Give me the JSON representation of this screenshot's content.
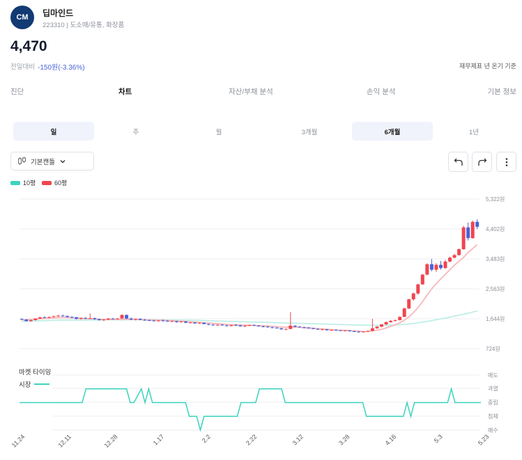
{
  "company": {
    "logo_text": "CM",
    "name": "딥마인드",
    "subtitle": "223310 | 도소매/유통, 화장품"
  },
  "quote": {
    "price": "4,470",
    "change_label": "전일대비",
    "change_value": "-150원(-3.36%)",
    "basis_note": "재무제표 년 온기 기준"
  },
  "tabs": [
    {
      "label": "진단",
      "active": false
    },
    {
      "label": "차트",
      "active": true
    },
    {
      "label": "자산/부채 분석",
      "active": false
    },
    {
      "label": "손익 분석",
      "active": false
    },
    {
      "label": "기본 정보",
      "active": false
    }
  ],
  "periods": [
    {
      "label": "일",
      "active": true
    },
    {
      "label": "주",
      "active": false
    },
    {
      "label": "월",
      "active": false
    },
    {
      "label": "3개월",
      "active": false
    },
    {
      "label": "6개월",
      "active": true
    },
    {
      "label": "1년",
      "active": false
    }
  ],
  "toolbar": {
    "chart_type_label": "기본캔들"
  },
  "icons": [
    "candle-icon",
    "chevron-down-icon",
    "undo-icon",
    "redo-icon",
    "more-vertical-icon"
  ],
  "colors": {
    "up": "#f0454f",
    "down": "#4a62d6",
    "ma10": "#3cd3bd",
    "ma60": "#f0454f"
  },
  "chart_data": [
    {
      "type": "candlestick",
      "legend": [
        {
          "name": "10평",
          "color": "#3cd3bd"
        },
        {
          "name": "60평",
          "color": "#f0454f"
        }
      ],
      "y_ticks": [
        "5,322원",
        "4,402원",
        "3,483원",
        "2,563원",
        "1,644원",
        "724원"
      ],
      "y_tick_values": [
        5322,
        4402,
        3483,
        2563,
        1644,
        724
      ],
      "ylim": [
        724,
        5322
      ],
      "x_ticks": [
        "11.24",
        "12.11",
        "12.28",
        "1.17",
        "2.2",
        "2.22",
        "3.12",
        "3.28",
        "4.16",
        "5.3",
        "5.23"
      ],
      "grid": true,
      "ohlc": [
        [
          1640,
          1650,
          1600,
          1620
        ],
        [
          1620,
          1630,
          1560,
          1570
        ],
        [
          1570,
          1620,
          1550,
          1600
        ],
        [
          1600,
          1660,
          1590,
          1650
        ],
        [
          1650,
          1700,
          1640,
          1690
        ],
        [
          1690,
          1720,
          1660,
          1680
        ],
        [
          1680,
          1710,
          1650,
          1700
        ],
        [
          1700,
          1740,
          1680,
          1720
        ],
        [
          1720,
          1760,
          1700,
          1740
        ],
        [
          1740,
          1770,
          1710,
          1730
        ],
        [
          1730,
          1740,
          1680,
          1700
        ],
        [
          1700,
          1720,
          1660,
          1690
        ],
        [
          1690,
          1700,
          1620,
          1640
        ],
        [
          1640,
          1680,
          1620,
          1670
        ],
        [
          1670,
          1690,
          1630,
          1650
        ],
        [
          1650,
          1800,
          1640,
          1660
        ],
        [
          1660,
          1680,
          1610,
          1630
        ],
        [
          1630,
          1650,
          1590,
          1600
        ],
        [
          1600,
          1630,
          1570,
          1620
        ],
        [
          1620,
          1660,
          1600,
          1650
        ],
        [
          1650,
          1670,
          1620,
          1640
        ],
        [
          1640,
          1660,
          1620,
          1650
        ],
        [
          1650,
          1780,
          1640,
          1760
        ],
        [
          1760,
          1770,
          1630,
          1650
        ],
        [
          1650,
          1680,
          1600,
          1620
        ],
        [
          1620,
          1650,
          1590,
          1640
        ],
        [
          1640,
          1660,
          1600,
          1610
        ],
        [
          1610,
          1640,
          1580,
          1600
        ],
        [
          1600,
          1620,
          1570,
          1590
        ],
        [
          1590,
          1610,
          1560,
          1570
        ],
        [
          1570,
          1600,
          1550,
          1590
        ],
        [
          1590,
          1620,
          1560,
          1580
        ],
        [
          1580,
          1600,
          1550,
          1560
        ],
        [
          1560,
          1590,
          1540,
          1570
        ],
        [
          1570,
          1580,
          1520,
          1540
        ],
        [
          1540,
          1570,
          1520,
          1560
        ],
        [
          1560,
          1570,
          1510,
          1520
        ],
        [
          1520,
          1550,
          1500,
          1530
        ],
        [
          1530,
          1540,
          1490,
          1500
        ],
        [
          1500,
          1530,
          1480,
          1520
        ],
        [
          1520,
          1530,
          1470,
          1480
        ],
        [
          1480,
          1500,
          1440,
          1460
        ],
        [
          1460,
          1480,
          1430,
          1440
        ],
        [
          1440,
          1470,
          1420,
          1460
        ],
        [
          1460,
          1480,
          1430,
          1440
        ],
        [
          1440,
          1460,
          1400,
          1420
        ],
        [
          1420,
          1460,
          1410,
          1450
        ],
        [
          1450,
          1480,
          1420,
          1440
        ],
        [
          1440,
          1460,
          1400,
          1410
        ],
        [
          1410,
          1440,
          1390,
          1430
        ],
        [
          1430,
          1460,
          1410,
          1450
        ],
        [
          1450,
          1470,
          1420,
          1430
        ],
        [
          1430,
          1450,
          1400,
          1410
        ],
        [
          1410,
          1430,
          1380,
          1400
        ],
        [
          1400,
          1430,
          1370,
          1380
        ],
        [
          1380,
          1400,
          1350,
          1370
        ],
        [
          1370,
          1390,
          1340,
          1350
        ],
        [
          1350,
          1360,
          1300,
          1320
        ],
        [
          1320,
          1340,
          1290,
          1330
        ],
        [
          1330,
          1850,
          1320,
          1430
        ],
        [
          1430,
          1440,
          1380,
          1400
        ],
        [
          1400,
          1420,
          1370,
          1380
        ],
        [
          1380,
          1400,
          1350,
          1370
        ],
        [
          1370,
          1390,
          1340,
          1350
        ],
        [
          1350,
          1370,
          1320,
          1330
        ],
        [
          1330,
          1350,
          1300,
          1310
        ],
        [
          1310,
          1340,
          1290,
          1320
        ],
        [
          1320,
          1330,
          1280,
          1290
        ],
        [
          1290,
          1310,
          1270,
          1300
        ],
        [
          1300,
          1320,
          1280,
          1290
        ],
        [
          1290,
          1300,
          1260,
          1270
        ],
        [
          1270,
          1290,
          1260,
          1280
        ],
        [
          1280,
          1300,
          1250,
          1260
        ],
        [
          1260,
          1280,
          1240,
          1250
        ],
        [
          1250,
          1260,
          1210,
          1230
        ],
        [
          1230,
          1260,
          1220,
          1250
        ],
        [
          1250,
          1280,
          1240,
          1270
        ],
        [
          1270,
          1640,
          1260,
          1350
        ],
        [
          1350,
          1420,
          1330,
          1400
        ],
        [
          1400,
          1480,
          1380,
          1470
        ],
        [
          1470,
          1560,
          1450,
          1540
        ],
        [
          1540,
          1600,
          1520,
          1580
        ],
        [
          1580,
          1620,
          1550,
          1600
        ],
        [
          1600,
          1720,
          1590,
          1700
        ],
        [
          1700,
          1980,
          1690,
          1960
        ],
        [
          1960,
          2260,
          1940,
          2240
        ],
        [
          2240,
          2450,
          2200,
          2420
        ],
        [
          2420,
          2720,
          2380,
          2700
        ],
        [
          2700,
          3020,
          2680,
          3000
        ],
        [
          3000,
          3350,
          2980,
          3320
        ],
        [
          3320,
          3480,
          3100,
          3150
        ],
        [
          3150,
          3350,
          3080,
          3300
        ],
        [
          3300,
          3420,
          3150,
          3200
        ],
        [
          3200,
          3450,
          3180,
          3400
        ],
        [
          3400,
          3550,
          3380,
          3520
        ],
        [
          3520,
          3640,
          3500,
          3600
        ],
        [
          3600,
          3800,
          3580,
          3780
        ],
        [
          3780,
          4500,
          3760,
          4450
        ],
        [
          4450,
          4600,
          4050,
          4120
        ],
        [
          4120,
          4660,
          4100,
          4620
        ],
        [
          4620,
          4700,
          4400,
          4470
        ]
      ],
      "ma10": [
        1600,
        1610,
        1620,
        1630,
        1640,
        1650,
        1660,
        1670,
        1680,
        1680,
        1680,
        1670,
        1660,
        1650,
        1650,
        1640,
        1640,
        1630,
        1620,
        1620,
        1620,
        1620,
        1620,
        1630,
        1620,
        1620,
        1620,
        1610,
        1610,
        1600,
        1600,
        1600,
        1590,
        1580,
        1570,
        1570,
        1560,
        1550,
        1540,
        1530,
        1520,
        1510,
        1500,
        1490,
        1480,
        1470,
        1460,
        1460,
        1450,
        1450,
        1440,
        1440,
        1430,
        1430,
        1420,
        1410,
        1400,
        1390,
        1380,
        1390,
        1380,
        1380,
        1370,
        1360,
        1350,
        1340,
        1330,
        1320,
        1310,
        1300,
        1290,
        1290,
        1280,
        1270,
        1260,
        1250,
        1250,
        1270,
        1290,
        1320,
        1360,
        1410,
        1460,
        1520,
        1600,
        1700,
        1830,
        1990,
        2170,
        2370,
        2560,
        2720,
        2870,
        3010,
        3150,
        3290,
        3410,
        3530,
        3680,
        3800,
        3920
      ],
      "ma60": [
        1560,
        1565,
        1570,
        1575,
        1580,
        1585,
        1590,
        1595,
        1600,
        1600,
        1600,
        1600,
        1600,
        1600,
        1605,
        1605,
        1605,
        1605,
        1610,
        1610,
        1610,
        1610,
        1610,
        1612,
        1612,
        1612,
        1612,
        1612,
        1612,
        1612,
        1610,
        1608,
        1606,
        1604,
        1602,
        1600,
        1598,
        1596,
        1594,
        1590,
        1586,
        1582,
        1578,
        1574,
        1570,
        1566,
        1562,
        1558,
        1554,
        1550,
        1546,
        1542,
        1538,
        1534,
        1530,
        1526,
        1522,
        1518,
        1514,
        1510,
        1506,
        1502,
        1498,
        1494,
        1490,
        1486,
        1482,
        1478,
        1474,
        1470,
        1466,
        1462,
        1458,
        1454,
        1450,
        1446,
        1442,
        1440,
        1440,
        1440,
        1442,
        1446,
        1452,
        1460,
        1470,
        1482,
        1498,
        1518,
        1540,
        1562,
        1586,
        1612,
        1638,
        1666,
        1694,
        1722,
        1752,
        1782,
        1814,
        1846,
        1880
      ]
    },
    {
      "type": "line",
      "title": "마켓 타이밍",
      "series": [
        {
          "name": "시장",
          "color": "#3cd3bd"
        }
      ],
      "y_ticks": [
        "매도",
        "과열",
        "중립",
        "침체",
        "매수"
      ],
      "levels": [
        2,
        2,
        2,
        2,
        2,
        2,
        2,
        2,
        2,
        2,
        2,
        2,
        2,
        2,
        2,
        2,
        2,
        2,
        3,
        3,
        3,
        3,
        3,
        3,
        3,
        3,
        3,
        3,
        3,
        3,
        2,
        2,
        2.5,
        3,
        2,
        3,
        2,
        2,
        2,
        2,
        2,
        2,
        2,
        2,
        2,
        2,
        1,
        1,
        1,
        0,
        1,
        1,
        1,
        1,
        1,
        1,
        1,
        1,
        1,
        1,
        2,
        2,
        2,
        2,
        2,
        3,
        3,
        3,
        3,
        3,
        3,
        3,
        2,
        2,
        2,
        2,
        2,
        2,
        2,
        2,
        2,
        2,
        2,
        2,
        2,
        2,
        2,
        2,
        2,
        2,
        2,
        2,
        2,
        2,
        1,
        1,
        1,
        1,
        1,
        1,
        1,
        1,
        1,
        1,
        1,
        2,
        1,
        2,
        2,
        2,
        2,
        2,
        2,
        2,
        2,
        2,
        2,
        3,
        2,
        2,
        2,
        2,
        2,
        2,
        2,
        2
      ]
    }
  ]
}
